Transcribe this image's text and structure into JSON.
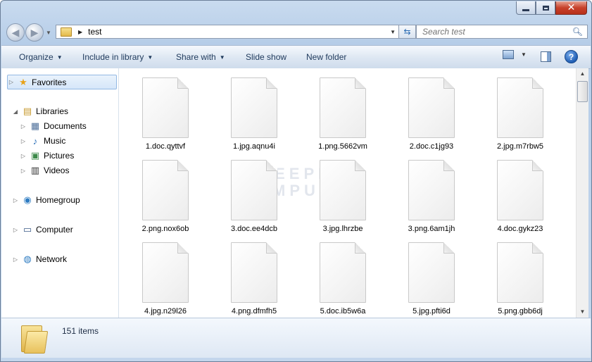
{
  "address": {
    "path": "test"
  },
  "search": {
    "placeholder": "Search test"
  },
  "toolbar": {
    "organize": "Organize",
    "include_in_library": "Include in library",
    "share_with": "Share with",
    "slide_show": "Slide show",
    "new_folder": "New folder"
  },
  "nav": {
    "favorites": "Favorites",
    "libraries": "Libraries",
    "documents": "Documents",
    "music": "Music",
    "pictures": "Pictures",
    "videos": "Videos",
    "homegroup": "Homegroup",
    "computer": "Computer",
    "network": "Network"
  },
  "watermark": {
    "line1": "BLEEPING",
    "line2": "COMPUTER"
  },
  "files": [
    "1.doc.qyttvf",
    "1.jpg.aqnu4i",
    "1.png.5662vm",
    "2.doc.c1jg93",
    "2.jpg.m7rbw5",
    "2.png.nox6ob",
    "3.doc.ee4dcb",
    "3.jpg.lhrzbe",
    "3.png.6am1jh",
    "4.doc.gykz23",
    "4.jpg.n29l26",
    "4.png.dfmfh5",
    "5.doc.ib5w6a",
    "5.jpg.pfti6d",
    "5.png.gbb6dj"
  ],
  "details": {
    "item_count": "151 items"
  }
}
